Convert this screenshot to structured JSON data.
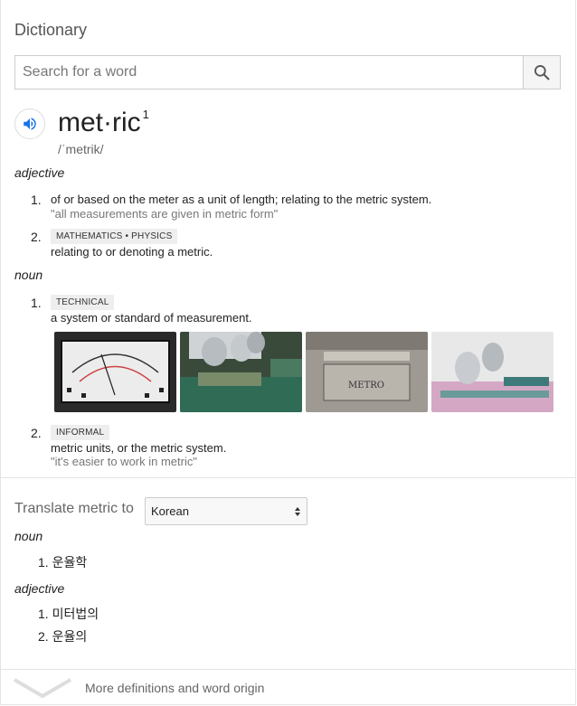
{
  "header": {
    "title": "Dictionary"
  },
  "search": {
    "placeholder": "Search for a word",
    "button_icon": "search-icon"
  },
  "entry": {
    "word": "met·ric",
    "homograph": "1",
    "phonetic": "/ˈmetrik/",
    "speaker_icon": "speaker-icon"
  },
  "sections": {
    "adjective": {
      "pos": "adjective",
      "senses": [
        {
          "num": "1.",
          "def": "of or based on the meter as a unit of length; relating to the metric system.",
          "example": "\"all measurements are given in metric form\""
        },
        {
          "num": "2.",
          "label": "MATHEMATICS • PHYSICS",
          "def": "relating to or denoting a metric."
        }
      ]
    },
    "noun": {
      "pos": "noun",
      "senses": [
        {
          "num": "1.",
          "label": "TECHNICAL",
          "def": "a system or standard of measurement."
        },
        {
          "num": "2.",
          "label": "INFORMAL",
          "def": "metric units, or the metric system.",
          "example": "\"it's easier to work in metric\""
        }
      ]
    }
  },
  "images": [
    "meter-gauge-image",
    "microscope-image",
    "metro-plaque-image",
    "microscope-circuit-image"
  ],
  "translate": {
    "label": "Translate metric to",
    "language": "Korean",
    "noun_pos": "noun",
    "noun_items": [
      {
        "num": "1.",
        "text": "운율학"
      }
    ],
    "adj_pos": "adjective",
    "adj_items": [
      {
        "num": "1.",
        "text": "미터법의"
      },
      {
        "num": "2.",
        "text": "운율의"
      }
    ]
  },
  "footer": {
    "more_label": "More definitions and word origin"
  },
  "colors": {
    "accent": "#1a73e8",
    "label_bg": "#eeeeee",
    "example_text": "#777777"
  }
}
